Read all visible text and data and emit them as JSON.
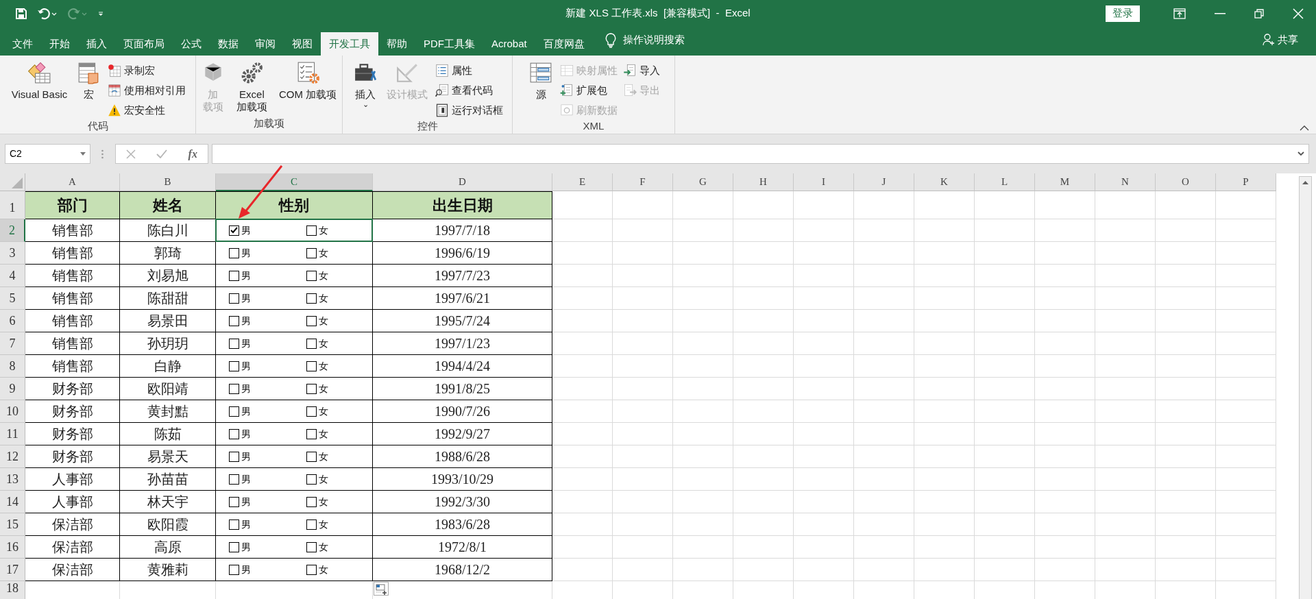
{
  "window": {
    "title": "新建 XLS 工作表.xls  [兼容模式]  -  Excel",
    "sign_in": "登录"
  },
  "menu_tabs": [
    {
      "label": "文件",
      "selected": false
    },
    {
      "label": "开始",
      "selected": false
    },
    {
      "label": "插入",
      "selected": false
    },
    {
      "label": "页面布局",
      "selected": false
    },
    {
      "label": "公式",
      "selected": false
    },
    {
      "label": "数据",
      "selected": false
    },
    {
      "label": "审阅",
      "selected": false
    },
    {
      "label": "视图",
      "selected": false
    },
    {
      "label": "开发工具",
      "selected": true
    },
    {
      "label": "帮助",
      "selected": false
    },
    {
      "label": "PDF工具集",
      "selected": false
    },
    {
      "label": "Acrobat",
      "selected": false
    },
    {
      "label": "百度网盘",
      "selected": false
    }
  ],
  "tell_me": "操作说明搜索",
  "share": "共享",
  "ribbon_groups": [
    {
      "label": "代码",
      "items": [
        {
          "kind": "large",
          "label": "Visual Basic",
          "disabled": false
        },
        {
          "kind": "large",
          "label": "宏",
          "disabled": false
        },
        {
          "kind": "stack",
          "items": [
            {
              "label": "录制宏",
              "disabled": false
            },
            {
              "label": "使用相对引用",
              "disabled": false
            },
            {
              "label": "宏安全性",
              "disabled": false
            }
          ]
        }
      ]
    },
    {
      "label": "加载项",
      "items": [
        {
          "kind": "large_narrow",
          "label": "加载项",
          "disabled": true
        },
        {
          "kind": "large_wrapped",
          "label": "Excel 加载项",
          "disabled": false
        },
        {
          "kind": "large",
          "label": "COM 加载项",
          "disabled": false
        }
      ]
    },
    {
      "label": "控件",
      "items": [
        {
          "kind": "large",
          "label": "插入",
          "disabled": false,
          "caret": "⌄"
        },
        {
          "kind": "large",
          "label": "设计模式",
          "disabled": true
        },
        {
          "kind": "stack",
          "items": [
            {
              "label": "属性",
              "disabled": false
            },
            {
              "label": "查看代码",
              "disabled": false
            },
            {
              "label": "运行对话框",
              "disabled": false
            }
          ]
        }
      ]
    },
    {
      "label": "XML",
      "items": [
        {
          "kind": "large",
          "label": "源",
          "disabled": false
        },
        {
          "kind": "stack",
          "items": [
            {
              "label": "映射属性",
              "disabled": true
            },
            {
              "label": "扩展包",
              "disabled": false
            },
            {
              "label": "刷新数据",
              "disabled": true
            }
          ]
        },
        {
          "kind": "stack",
          "items": [
            {
              "label": "导入",
              "disabled": false
            },
            {
              "label": "导出",
              "disabled": true
            }
          ]
        }
      ]
    }
  ],
  "formula_bar": {
    "name_box": "C2",
    "fx": "fx"
  },
  "columns": [
    {
      "label": "A",
      "selected": false
    },
    {
      "label": "B",
      "selected": false
    },
    {
      "label": "C",
      "selected": true
    },
    {
      "label": "D",
      "selected": false
    },
    {
      "label": "E",
      "selected": false
    },
    {
      "label": "F",
      "selected": false
    },
    {
      "label": "G",
      "selected": false
    },
    {
      "label": "H",
      "selected": false
    },
    {
      "label": "I",
      "selected": false
    },
    {
      "label": "J",
      "selected": false
    },
    {
      "label": "K",
      "selected": false
    },
    {
      "label": "L",
      "selected": false
    },
    {
      "label": "M",
      "selected": false
    },
    {
      "label": "N",
      "selected": false
    },
    {
      "label": "O",
      "selected": false
    },
    {
      "label": "P",
      "selected": false
    }
  ],
  "rows": [
    {
      "number": "1",
      "kind": "header",
      "selected": false,
      "cells": [
        "部门",
        "姓名",
        "性别",
        "出生日期"
      ]
    },
    {
      "number": "2",
      "kind": "data",
      "selected": true,
      "department": "销售部",
      "name": "陈白川",
      "gender": [
        {
          "label": "男",
          "checked": true
        },
        {
          "label": "女",
          "checked": false
        }
      ],
      "birth_date": "1997/7/18"
    },
    {
      "number": "3",
      "kind": "data",
      "selected": false,
      "department": "销售部",
      "name": "郭琦",
      "gender": [
        {
          "label": "男",
          "checked": false
        },
        {
          "label": "女",
          "checked": false
        }
      ],
      "birth_date": "1996/6/19"
    },
    {
      "number": "4",
      "kind": "data",
      "selected": false,
      "department": "销售部",
      "name": "刘易旭",
      "gender": [
        {
          "label": "男",
          "checked": false
        },
        {
          "label": "女",
          "checked": false
        }
      ],
      "birth_date": "1997/7/23"
    },
    {
      "number": "5",
      "kind": "data",
      "selected": false,
      "department": "销售部",
      "name": "陈甜甜",
      "gender": [
        {
          "label": "男",
          "checked": false
        },
        {
          "label": "女",
          "checked": false
        }
      ],
      "birth_date": "1997/6/21"
    },
    {
      "number": "6",
      "kind": "data",
      "selected": false,
      "department": "销售部",
      "name": "易景田",
      "gender": [
        {
          "label": "男",
          "checked": false
        },
        {
          "label": "女",
          "checked": false
        }
      ],
      "birth_date": "1995/7/24"
    },
    {
      "number": "7",
      "kind": "data",
      "selected": false,
      "department": "销售部",
      "name": "孙玥玥",
      "gender": [
        {
          "label": "男",
          "checked": false
        },
        {
          "label": "女",
          "checked": false
        }
      ],
      "birth_date": "1997/1/23"
    },
    {
      "number": "8",
      "kind": "data",
      "selected": false,
      "department": "销售部",
      "name": "白静",
      "gender": [
        {
          "label": "男",
          "checked": false
        },
        {
          "label": "女",
          "checked": false
        }
      ],
      "birth_date": "1994/4/24"
    },
    {
      "number": "9",
      "kind": "data",
      "selected": false,
      "department": "财务部",
      "name": "欧阳靖",
      "gender": [
        {
          "label": "男",
          "checked": false
        },
        {
          "label": "女",
          "checked": false
        }
      ],
      "birth_date": "1991/8/25"
    },
    {
      "number": "10",
      "kind": "data",
      "selected": false,
      "department": "财务部",
      "name": "黄封黠",
      "gender": [
        {
          "label": "男",
          "checked": false
        },
        {
          "label": "女",
          "checked": false
        }
      ],
      "birth_date": "1990/7/26"
    },
    {
      "number": "11",
      "kind": "data",
      "selected": false,
      "department": "财务部",
      "name": "陈茹",
      "gender": [
        {
          "label": "男",
          "checked": false
        },
        {
          "label": "女",
          "checked": false
        }
      ],
      "birth_date": "1992/9/27"
    },
    {
      "number": "12",
      "kind": "data",
      "selected": false,
      "department": "财务部",
      "name": "易景天",
      "gender": [
        {
          "label": "男",
          "checked": false
        },
        {
          "label": "女",
          "checked": false
        }
      ],
      "birth_date": "1988/6/28"
    },
    {
      "number": "13",
      "kind": "data",
      "selected": false,
      "department": "人事部",
      "name": "孙苗苗",
      "gender": [
        {
          "label": "男",
          "checked": false
        },
        {
          "label": "女",
          "checked": false
        }
      ],
      "birth_date": "1993/10/29"
    },
    {
      "number": "14",
      "kind": "data",
      "selected": false,
      "department": "人事部",
      "name": "林天宇",
      "gender": [
        {
          "label": "男",
          "checked": false
        },
        {
          "label": "女",
          "checked": false
        }
      ],
      "birth_date": "1992/3/30"
    },
    {
      "number": "15",
      "kind": "data",
      "selected": false,
      "department": "保洁部",
      "name": "欧阳霞",
      "gender": [
        {
          "label": "男",
          "checked": false
        },
        {
          "label": "女",
          "checked": false
        }
      ],
      "birth_date": "1983/6/28"
    },
    {
      "number": "16",
      "kind": "data",
      "selected": false,
      "department": "保洁部",
      "name": "高原",
      "gender": [
        {
          "label": "男",
          "checked": false
        },
        {
          "label": "女",
          "checked": false
        }
      ],
      "birth_date": "1972/8/1"
    },
    {
      "number": "17",
      "kind": "data",
      "selected": false,
      "department": "保洁部",
      "name": "黄雅莉",
      "gender": [
        {
          "label": "男",
          "checked": false
        },
        {
          "label": "女",
          "checked": false
        }
      ],
      "birth_date": "1968/12/2"
    },
    {
      "number": "18",
      "kind": "empty",
      "selected": false
    }
  ]
}
